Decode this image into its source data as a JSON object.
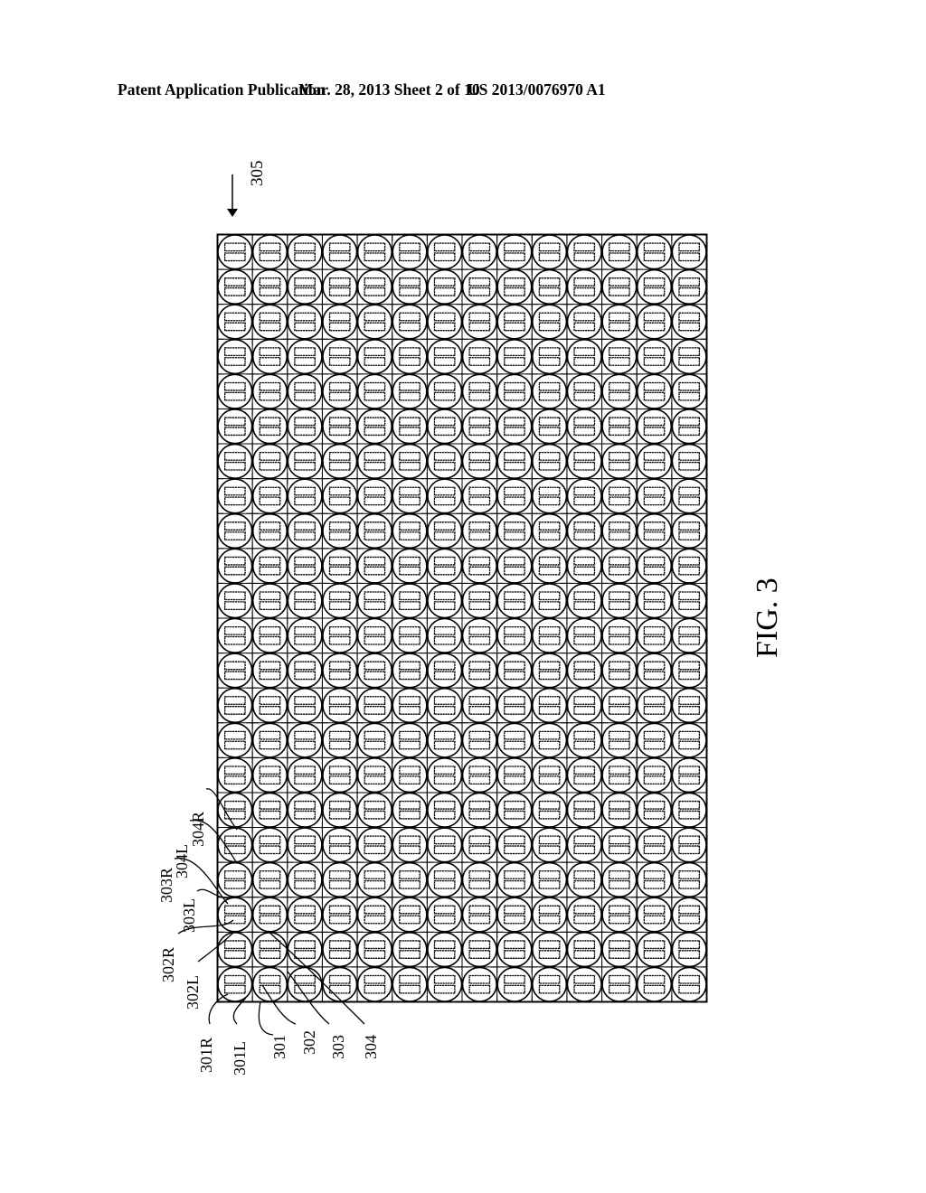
{
  "header": {
    "publication_type": "Patent Application Publication",
    "date_sheet": "Mar. 28, 2013  Sheet 2 of 10",
    "patent_number": "US 2013/0076970 A1"
  },
  "figure": {
    "caption": "FIG. 3",
    "array_reference": "305",
    "grid": {
      "columns": 14,
      "rows": 22
    },
    "cell_contents": [
      "circle",
      "upper-rectangle",
      "lower-rectangle"
    ],
    "reference_labels": [
      {
        "id": "301R",
        "text": "301R"
      },
      {
        "id": "301L",
        "text": "301L"
      },
      {
        "id": "301",
        "text": "301"
      },
      {
        "id": "302",
        "text": "302"
      },
      {
        "id": "303",
        "text": "303"
      },
      {
        "id": "304",
        "text": "304"
      },
      {
        "id": "302L",
        "text": "302L"
      },
      {
        "id": "302R",
        "text": "302R"
      },
      {
        "id": "303L",
        "text": "303L"
      },
      {
        "id": "303R",
        "text": "303R"
      },
      {
        "id": "304L",
        "text": "304L"
      },
      {
        "id": "304R",
        "text": "304R"
      }
    ]
  },
  "colors": {
    "ink": "#000000",
    "paper": "#ffffff"
  }
}
